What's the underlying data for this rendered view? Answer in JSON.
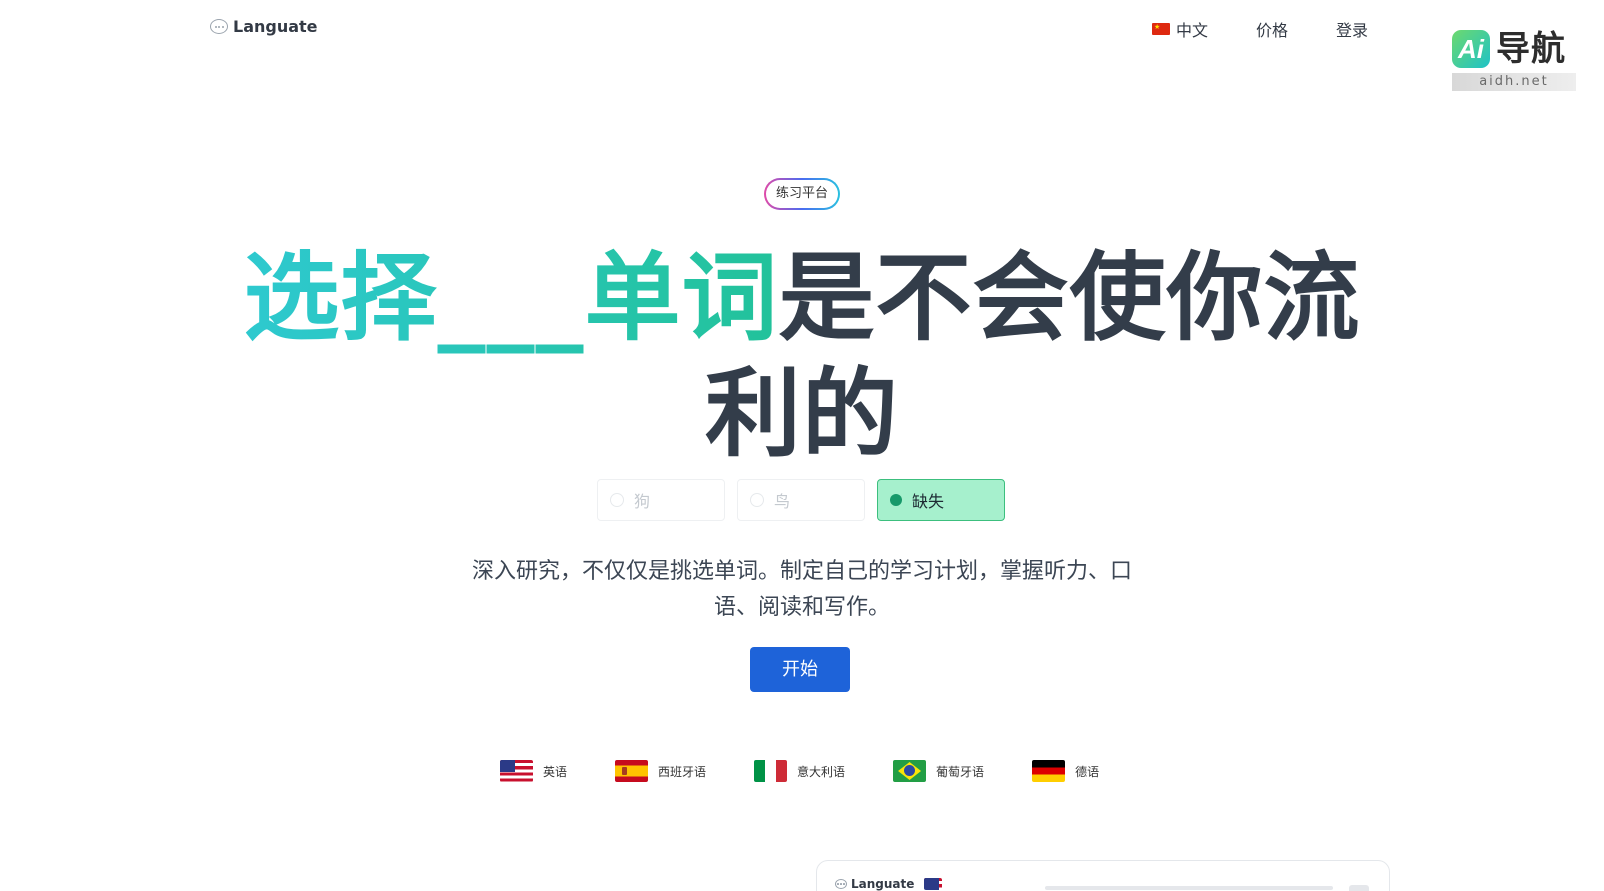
{
  "header": {
    "brand": "Languate",
    "nav": {
      "language": "中文",
      "pricing": "价格",
      "login": "登录"
    }
  },
  "watermark": {
    "logo_letters": "Ai",
    "title": "导航",
    "subtitle": "aidh.net"
  },
  "hero": {
    "badge": "练习平台",
    "headline_accent": "选择___单词",
    "headline_rest": "是不会使你流利的",
    "options": [
      {
        "label": "狗",
        "selected": false
      },
      {
        "label": "鸟",
        "selected": false
      },
      {
        "label": "缺失",
        "selected": true
      }
    ],
    "description": "深入研究，不仅仅是挑选单词。制定自己的学习计划，掌握听力、口语、阅读和写作。",
    "cta": "开始"
  },
  "languages": [
    {
      "label": "英语",
      "icon": "us-flag-icon"
    },
    {
      "label": "西班牙语",
      "icon": "spain-flag-icon"
    },
    {
      "label": "意大利语",
      "icon": "italy-flag-icon"
    },
    {
      "label": "葡萄牙语",
      "icon": "brazil-flag-icon"
    },
    {
      "label": "德语",
      "icon": "germany-flag-icon"
    }
  ],
  "preview": {
    "brand": "Languate"
  },
  "colors": {
    "accent_start": "#2ec9cf",
    "accent_end": "#22c29a",
    "cta": "#1e63d9",
    "selected_option": "#a6f0cd"
  }
}
